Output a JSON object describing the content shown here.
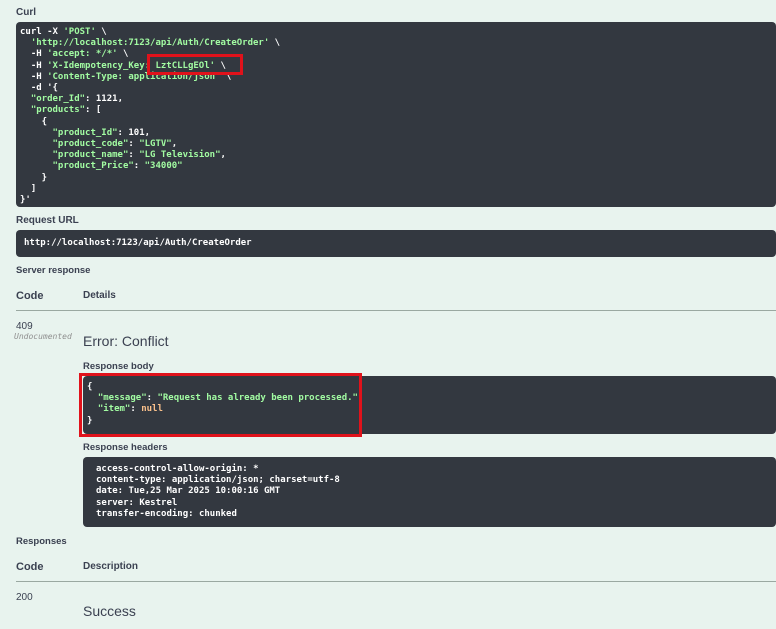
{
  "curl": {
    "label": "Curl",
    "lines": [
      "curl -X 'POST' \\",
      "  'http://localhost:7123/api/Auth/CreateOrder' \\",
      "  -H 'accept: */*' \\",
      "  -H 'X-Idempotency_Key: LztCLLgEOl' \\",
      "  -H 'Content-Type: application/json' \\",
      "  -d '{",
      "  \"order_Id\": 1121,",
      "  \"products\": [",
      "    {",
      "      \"product_Id\": 101,",
      "      \"product_code\": \"LGTV\",",
      "      \"product_name\": \"LG Television\",",
      "      \"product_Price\": \"34000\"",
      "    }",
      "  ]",
      "}'"
    ]
  },
  "request_url": {
    "label": "Request URL",
    "value": "http://localhost:7123/api/Auth/CreateOrder"
  },
  "server_response": {
    "label": "Server response",
    "code_header": "Code",
    "details_header": "Details",
    "code": "409",
    "code_note": "Undocumented",
    "error_text": "Error: Conflict",
    "body_label": "Response body",
    "body_lines": [
      "{",
      "  \"message\": \"Request has already been processed.\",",
      "  \"item\": null",
      "}"
    ],
    "headers_label": "Response headers",
    "headers_lines": [
      "access-control-allow-origin: *",
      "content-type: application/json; charset=utf-8",
      "date: Tue,25 Mar 2025 10:00:16 GMT",
      "server: Kestrel",
      "transfer-encoding: chunked"
    ]
  },
  "responses": {
    "label": "Responses",
    "code_header": "Code",
    "description_header": "Description",
    "code": "200",
    "description": "Success"
  },
  "colors": {
    "background": "#e8f3ee",
    "code_block": "#333840",
    "highlight": "#e0121b",
    "string_green": "#a2fca2"
  }
}
